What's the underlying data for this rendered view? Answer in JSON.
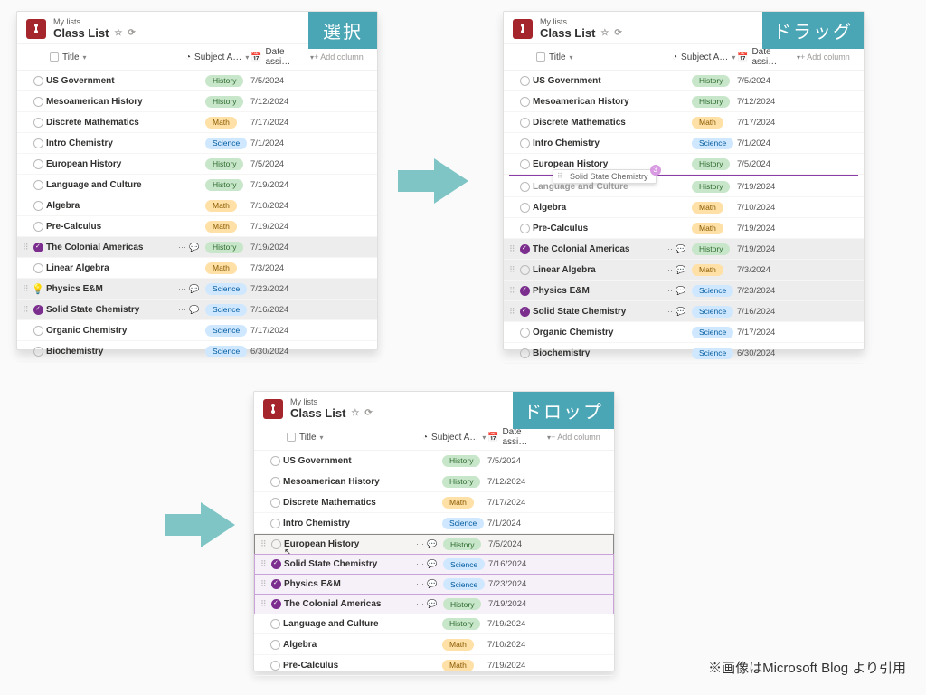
{
  "credit": "※画像はMicrosoft Blog\nより引用",
  "tags": {
    "select": "選択",
    "drag": "ドラッグ",
    "drop": "ドロップ"
  },
  "header": {
    "breadcrumb": "My lists",
    "title": "Class List"
  },
  "columns": {
    "title": "Title",
    "subject": "Subject A…",
    "date": "Date assi…",
    "add": "+ Add column"
  },
  "drag_ghost": {
    "label": "Solid State Chemistry",
    "badge": "3"
  },
  "panel1": [
    {
      "t": "US Government",
      "s": "History",
      "d": "7/5/2024"
    },
    {
      "t": "Mesoamerican History",
      "s": "History",
      "d": "7/12/2024"
    },
    {
      "t": "Discrete Mathematics",
      "s": "Math",
      "d": "7/17/2024"
    },
    {
      "t": "Intro Chemistry",
      "s": "Science",
      "d": "7/1/2024"
    },
    {
      "t": "European History",
      "s": "History",
      "d": "7/5/2024"
    },
    {
      "t": "Language and Culture",
      "s": "History",
      "d": "7/19/2024"
    },
    {
      "t": "Algebra",
      "s": "Math",
      "d": "7/10/2024"
    },
    {
      "t": "Pre-Calculus",
      "s": "Math",
      "d": "7/19/2024"
    },
    {
      "t": "The Colonial Americas",
      "s": "History",
      "d": "7/19/2024",
      "sel": true
    },
    {
      "t": "Linear Algebra",
      "s": "Math",
      "d": "7/3/2024"
    },
    {
      "t": "Physics E&M",
      "s": "Science",
      "d": "7/23/2024",
      "sel": true,
      "bulb": true
    },
    {
      "t": "Solid State Chemistry",
      "s": "Science",
      "d": "7/16/2024",
      "sel": true
    },
    {
      "t": "Organic Chemistry",
      "s": "Science",
      "d": "7/17/2024"
    },
    {
      "t": "Biochemistry",
      "s": "Science",
      "d": "6/30/2024"
    }
  ],
  "panel2": [
    {
      "t": "US Government",
      "s": "History",
      "d": "7/5/2024"
    },
    {
      "t": "Mesoamerican History",
      "s": "History",
      "d": "7/12/2024"
    },
    {
      "t": "Discrete Mathematics",
      "s": "Math",
      "d": "7/17/2024"
    },
    {
      "t": "Intro Chemistry",
      "s": "Science",
      "d": "7/1/2024"
    },
    {
      "t": "European History",
      "s": "History",
      "d": "7/5/2024"
    },
    {
      "insert": true
    },
    {
      "t": "Language and Culture",
      "s": "History",
      "d": "7/19/2024",
      "faint": true
    },
    {
      "t": "Algebra",
      "s": "Math",
      "d": "7/10/2024"
    },
    {
      "t": "Pre-Calculus",
      "s": "Math",
      "d": "7/19/2024"
    },
    {
      "t": "The Colonial Americas",
      "s": "History",
      "d": "7/19/2024",
      "sel": true
    },
    {
      "t": "Linear Algebra",
      "s": "Math",
      "d": "7/3/2024",
      "sel": true,
      "ring": true
    },
    {
      "t": "Physics E&M",
      "s": "Science",
      "d": "7/23/2024",
      "sel": true
    },
    {
      "t": "Solid State Chemistry",
      "s": "Science",
      "d": "7/16/2024",
      "sel": true
    },
    {
      "t": "Organic Chemistry",
      "s": "Science",
      "d": "7/17/2024"
    },
    {
      "t": "Biochemistry",
      "s": "Science",
      "d": "6/30/2024"
    }
  ],
  "panel3": [
    {
      "t": "US Government",
      "s": "History",
      "d": "7/5/2024"
    },
    {
      "t": "Mesoamerican History",
      "s": "History",
      "d": "7/12/2024"
    },
    {
      "t": "Discrete Mathematics",
      "s": "Math",
      "d": "7/17/2024"
    },
    {
      "t": "Intro Chemistry",
      "s": "Science",
      "d": "7/1/2024"
    },
    {
      "t": "European History",
      "s": "History",
      "d": "7/5/2024",
      "hover": true,
      "ring": true
    },
    {
      "t": "Solid State Chemistry",
      "s": "Science",
      "d": "7/16/2024",
      "moved": true,
      "sel": true
    },
    {
      "t": "Physics E&M",
      "s": "Science",
      "d": "7/23/2024",
      "moved": true,
      "sel": true
    },
    {
      "t": "The Colonial Americas",
      "s": "History",
      "d": "7/19/2024",
      "moved": true,
      "sel": true
    },
    {
      "t": "Language and Culture",
      "s": "History",
      "d": "7/19/2024"
    },
    {
      "t": "Algebra",
      "s": "Math",
      "d": "7/10/2024"
    },
    {
      "t": "Pre-Calculus",
      "s": "Math",
      "d": "7/19/2024"
    }
  ]
}
